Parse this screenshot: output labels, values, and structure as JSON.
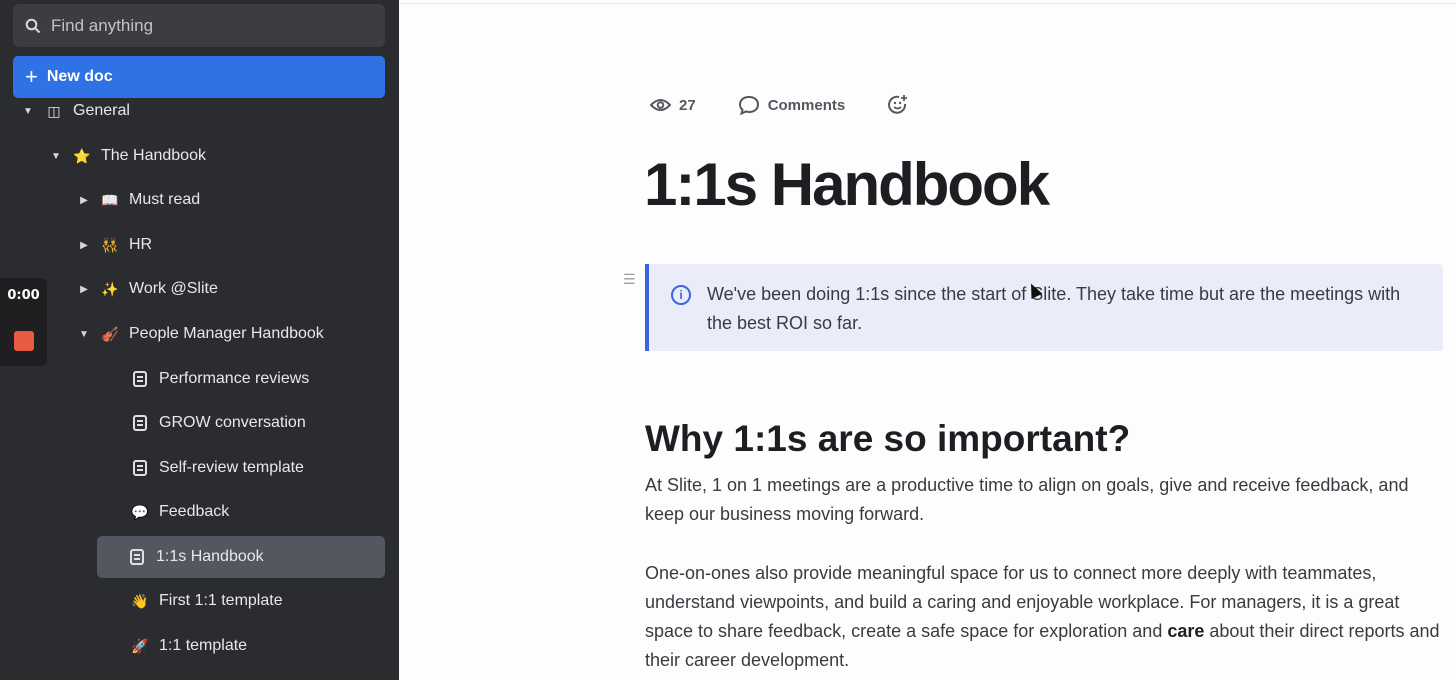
{
  "sidebar": {
    "search_placeholder": "Find anything",
    "new_doc_label": "New doc",
    "items": [
      {
        "label": "General",
        "caret": "▼",
        "icon": "book-icon",
        "glyph": "◫"
      },
      {
        "label": "The Handbook",
        "caret": "▼",
        "icon": "star-icon",
        "glyph": "⭐"
      },
      {
        "label": "Must read",
        "caret": "▶",
        "icon": "open-book-icon",
        "glyph": "📖"
      },
      {
        "label": "HR",
        "caret": "▶",
        "icon": "people-icon",
        "glyph": "👯"
      },
      {
        "label": "Work @Slite",
        "caret": "▶",
        "icon": "sparkles-icon",
        "glyph": "✨"
      },
      {
        "label": "People Manager Handbook",
        "caret": "▼",
        "icon": "violin-icon",
        "glyph": "🎻"
      },
      {
        "label": "Performance reviews",
        "caret": "",
        "icon": "doc-icon",
        "glyph": ""
      },
      {
        "label": "GROW conversation",
        "caret": "",
        "icon": "doc-icon",
        "glyph": ""
      },
      {
        "label": "Self-review template",
        "caret": "",
        "icon": "doc-icon",
        "glyph": ""
      },
      {
        "label": "Feedback",
        "caret": "",
        "icon": "speech-bubble-icon",
        "glyph": "💬"
      },
      {
        "label": "1:1s Handbook",
        "caret": "",
        "icon": "doc-icon",
        "glyph": "",
        "active": true
      },
      {
        "label": "First 1:1 template",
        "caret": "",
        "icon": "waving-hand-icon",
        "glyph": "👋"
      },
      {
        "label": "1:1 template",
        "caret": "",
        "icon": "rocket-icon",
        "glyph": "🚀"
      }
    ]
  },
  "recorder": {
    "time": "0:00"
  },
  "doc": {
    "views": "27",
    "comments_label": "Comments",
    "title": "1:1s Handbook",
    "callout": "We've been doing 1:1s since the start of Slite. They take time but are the meetings with the best ROI so far.",
    "heading": "Why 1:1s are so important?",
    "para1": "At Slite, 1 on 1 meetings are a productive time to align on goals, give and receive feedback, and keep our business moving forward.",
    "para2_a": "One-on-ones also provide meaningful space for us to connect more deeply with teammates, understand viewpoints, and build a caring and enjoyable workplace. For managers, it is a great space to share feedback, create a safe space for exploration and ",
    "para2_bold": "care",
    "para2_b": " about their direct reports and their career development."
  },
  "colors": {
    "accent": "#2f72e6",
    "sidebar_bg": "#2b2c30",
    "callout_bg": "#eaedf9",
    "callout_border": "#3a63de",
    "record": "#e85a42"
  }
}
